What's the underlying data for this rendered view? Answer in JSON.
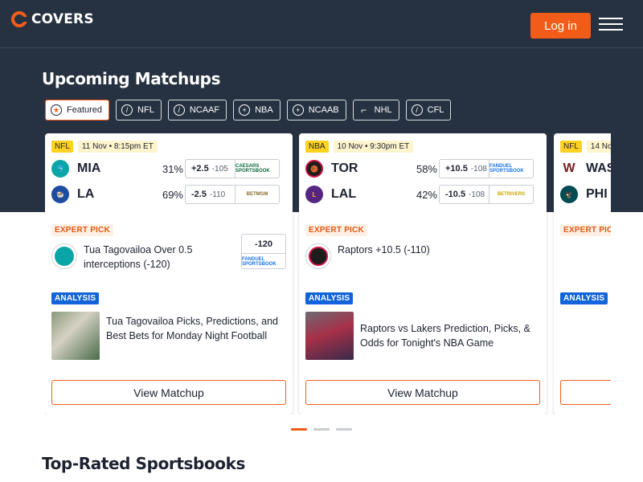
{
  "header": {
    "brand": "COVERS",
    "login_label": "Log in"
  },
  "section_title": "Upcoming Matchups",
  "filters": [
    {
      "label": "Featured",
      "icon": "star-icon",
      "active": true
    },
    {
      "label": "NFL",
      "icon": "football-icon"
    },
    {
      "label": "NCAAF",
      "icon": "football-icon"
    },
    {
      "label": "NBA",
      "icon": "basketball-icon"
    },
    {
      "label": "NCAAB",
      "icon": "basketball-icon"
    },
    {
      "label": "NHL",
      "icon": "hockey-stick-icon"
    },
    {
      "label": "CFL",
      "icon": "football-icon"
    }
  ],
  "cards": [
    {
      "league": "NFL",
      "date": "11 Nov • 8:15pm ET",
      "teams": [
        {
          "abbr": "MIA",
          "pct": "31%",
          "line": "+2.5",
          "price": "-105",
          "book": "CAESARS SPORTSBOOK",
          "color": "#0aa5a6"
        },
        {
          "abbr": "LA",
          "pct": "69%",
          "line": "-2.5",
          "price": "-110",
          "book": "BETMGM",
          "color": "#1c4da1"
        }
      ],
      "expert_label": "EXPERT PICK",
      "pick_text": "Tua Tagovailoa Over 0.5 interceptions (-120)",
      "pick_odds": "-120",
      "pick_book": "FANDUEL SPORTSBOOK",
      "analysis_label": "ANALYSIS",
      "analysis_text": "Tua Tagovailoa Picks, Predictions, and Best Bets for Monday Night Football",
      "button": "View Matchup"
    },
    {
      "league": "NBA",
      "date": "10 Nov • 9:30pm ET",
      "teams": [
        {
          "abbr": "TOR",
          "pct": "58%",
          "line": "+10.5",
          "price": "-108",
          "book": "FANDUEL SPORTSBOOK",
          "color": "#ce1141"
        },
        {
          "abbr": "LAL",
          "pct": "42%",
          "line": "-10.5",
          "price": "-108",
          "book": "BETRIVERS",
          "color": "#552583"
        }
      ],
      "expert_label": "EXPERT PICK",
      "pick_text": "Raptors +10.5 (-110)",
      "analysis_label": "ANALYSIS",
      "analysis_text": "Raptors vs Lakers Prediction, Picks, & Odds for Tonight's NBA Game",
      "button": "View Matchup"
    },
    {
      "league": "NFL",
      "date": "14 No",
      "teams": [
        {
          "abbr": "WAS",
          "color": "#5a1414"
        },
        {
          "abbr": "PHI",
          "color": "#004c54"
        }
      ],
      "expert_label": "EXPERT PICK",
      "analysis_label": "ANALYSIS"
    }
  ],
  "bottom_title": "Top-Rated Sportsbooks",
  "colors": {
    "accent": "#f25c19",
    "hero_bg": "#263241",
    "analysis": "#1264d8"
  }
}
